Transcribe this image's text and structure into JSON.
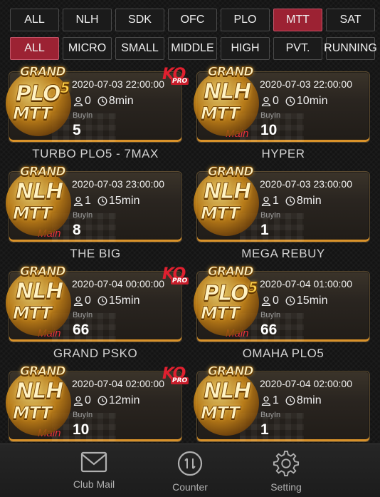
{
  "filters_row1": [
    {
      "label": "ALL",
      "active": false
    },
    {
      "label": "NLH",
      "active": false
    },
    {
      "label": "SDK",
      "active": false
    },
    {
      "label": "OFC",
      "active": false
    },
    {
      "label": "PLO",
      "active": false
    },
    {
      "label": "MTT",
      "active": true
    },
    {
      "label": "SAT",
      "active": false
    }
  ],
  "filters_row2": [
    {
      "label": "ALL",
      "active": true
    },
    {
      "label": "MICRO",
      "active": false
    },
    {
      "label": "SMALL",
      "active": false
    },
    {
      "label": "MIDDLE",
      "active": false
    },
    {
      "label": "HIGH",
      "active": false
    },
    {
      "label": "PVT.",
      "active": false
    },
    {
      "label": "RUNNING",
      "active": false
    }
  ],
  "logo_text": {
    "grand": "GRAND",
    "mtt": "MTT",
    "pro": "PRO",
    "ko": "KO"
  },
  "buyin_label": "BuyIn",
  "tournaments": [
    {
      "name": "",
      "game": "PLO",
      "plo5": true,
      "ko": true,
      "main": false,
      "datetime": "2020-07-03 22:00:00",
      "players": "0",
      "time": "8min",
      "buyin": "5"
    },
    {
      "name": "",
      "game": "NLH",
      "plo5": false,
      "ko": false,
      "main": true,
      "datetime": "2020-07-03 22:00:00",
      "players": "0",
      "time": "10min",
      "buyin": "10"
    },
    {
      "name": "TURBO PLO5 - 7MAX",
      "game": "NLH",
      "plo5": false,
      "ko": false,
      "main": true,
      "datetime": "2020-07-03 23:00:00",
      "players": "1",
      "time": "15min",
      "buyin": "8"
    },
    {
      "name": "HYPER",
      "game": "NLH",
      "plo5": false,
      "ko": false,
      "main": false,
      "datetime": "2020-07-03 23:00:00",
      "players": "1",
      "time": "8min",
      "buyin": "1"
    },
    {
      "name": "THE BIG",
      "game": "NLH",
      "plo5": false,
      "ko": true,
      "main": true,
      "datetime": "2020-07-04 00:00:00",
      "players": "0",
      "time": "15min",
      "buyin": "66"
    },
    {
      "name": "MEGA REBUY",
      "game": "PLO",
      "plo5": true,
      "ko": false,
      "main": true,
      "datetime": "2020-07-04 01:00:00",
      "players": "0",
      "time": "15min",
      "buyin": "66"
    },
    {
      "name": "GRAND PSKO",
      "game": "NLH",
      "plo5": false,
      "ko": true,
      "main": true,
      "datetime": "2020-07-04 02:00:00",
      "players": "0",
      "time": "12min",
      "buyin": "10"
    },
    {
      "name": "OMAHA PLO5",
      "game": "NLH",
      "plo5": false,
      "ko": false,
      "main": false,
      "datetime": "2020-07-04 02:00:00",
      "players": "1",
      "time": "8min",
      "buyin": "1"
    }
  ],
  "main_label": "Main",
  "bottom_nav": [
    {
      "label": "Club Mail",
      "icon": "mail-icon"
    },
    {
      "label": "Counter",
      "icon": "counter-icon"
    },
    {
      "label": "Setting",
      "icon": "gear-icon"
    }
  ],
  "colors": {
    "active_tab": "#9c2233",
    "accent_gold": "#d9922a",
    "main_red": "#e8303a"
  }
}
